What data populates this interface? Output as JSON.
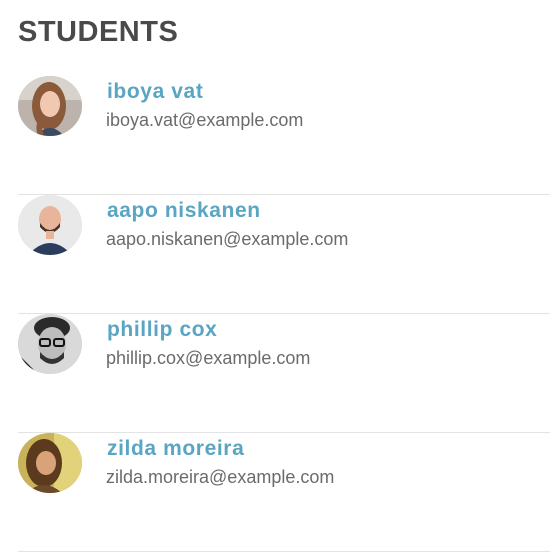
{
  "header": {
    "title": "STUDENTS"
  },
  "students": [
    {
      "name": "iboya vat",
      "email": "iboya.vat@example.com",
      "avatar_icon": "student-photo-woman-red-hair"
    },
    {
      "name": "aapo niskanen",
      "email": "aapo.niskanen@example.com",
      "avatar_icon": "student-photo-bald-man-beard"
    },
    {
      "name": "phillip cox",
      "email": "phillip.cox@example.com",
      "avatar_icon": "student-photo-man-glasses-bw"
    },
    {
      "name": "zilda moreira",
      "email": "zilda.moreira@example.com",
      "avatar_icon": "student-photo-woman-warm-tones"
    }
  ],
  "colors": {
    "name_link": "#5aa5c2",
    "email_text": "#6b6b6b",
    "title_text": "#4a4a4a",
    "divider": "#e3e3e3"
  }
}
